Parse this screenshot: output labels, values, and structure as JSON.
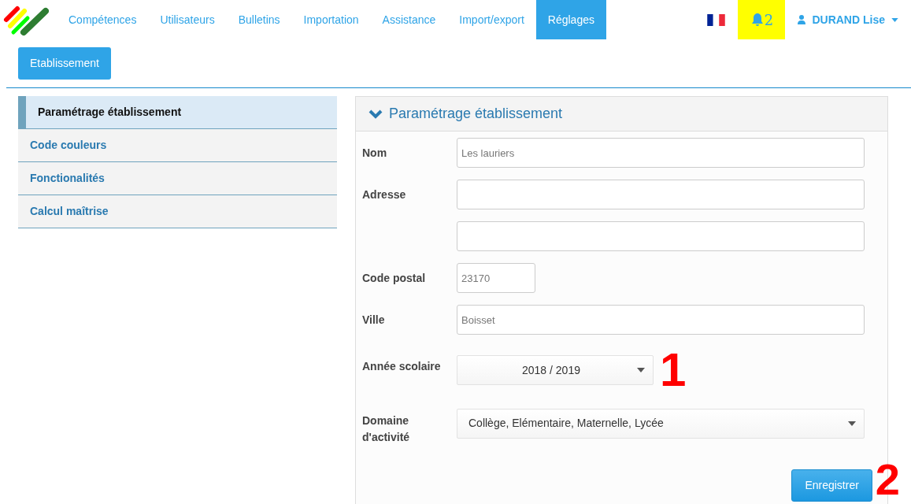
{
  "navbar": {
    "items": [
      {
        "label": "Compétences",
        "selected": false
      },
      {
        "label": "Utilisateurs",
        "selected": false
      },
      {
        "label": "Bulletins",
        "selected": false
      },
      {
        "label": "Importation",
        "selected": false
      },
      {
        "label": "Assistance",
        "selected": false
      },
      {
        "label": "Import/export",
        "selected": false
      },
      {
        "label": "Réglages",
        "selected": true
      }
    ],
    "notifications": {
      "count": "2"
    },
    "user": {
      "name": "DURAND Lise"
    }
  },
  "subnav": {
    "buttons": [
      {
        "label": "Etablissement",
        "selected": true
      }
    ]
  },
  "sidebar": {
    "items": [
      {
        "label": "Paramétrage établissement",
        "selected": true
      },
      {
        "label": "Code couleurs",
        "selected": false
      },
      {
        "label": "Fonctionalités",
        "selected": false
      },
      {
        "label": "Calcul maîtrise",
        "selected": false
      }
    ]
  },
  "panel": {
    "title": "Paramétrage établissement",
    "fields": [
      {
        "kind": "text",
        "label": "Nom",
        "placeholder": "Les lauriers"
      },
      {
        "kind": "text",
        "label": "Adresse"
      },
      {
        "kind": "text"
      },
      {
        "kind": "short",
        "label": "Code postal",
        "placeholder": "23170"
      },
      {
        "kind": "text",
        "label": "Ville",
        "placeholder": "Boisset"
      },
      {
        "kind": "select",
        "label": "Année scolaire",
        "value": "2018 / 2019",
        "annotation": "1"
      },
      {
        "kind": "selectwide",
        "label": "Domaine d'activité",
        "value": "Collège, Elémentaire, Maternelle, Lycée"
      }
    ],
    "save_button": {
      "label": "Enregistrer",
      "annotation": "2"
    }
  }
}
